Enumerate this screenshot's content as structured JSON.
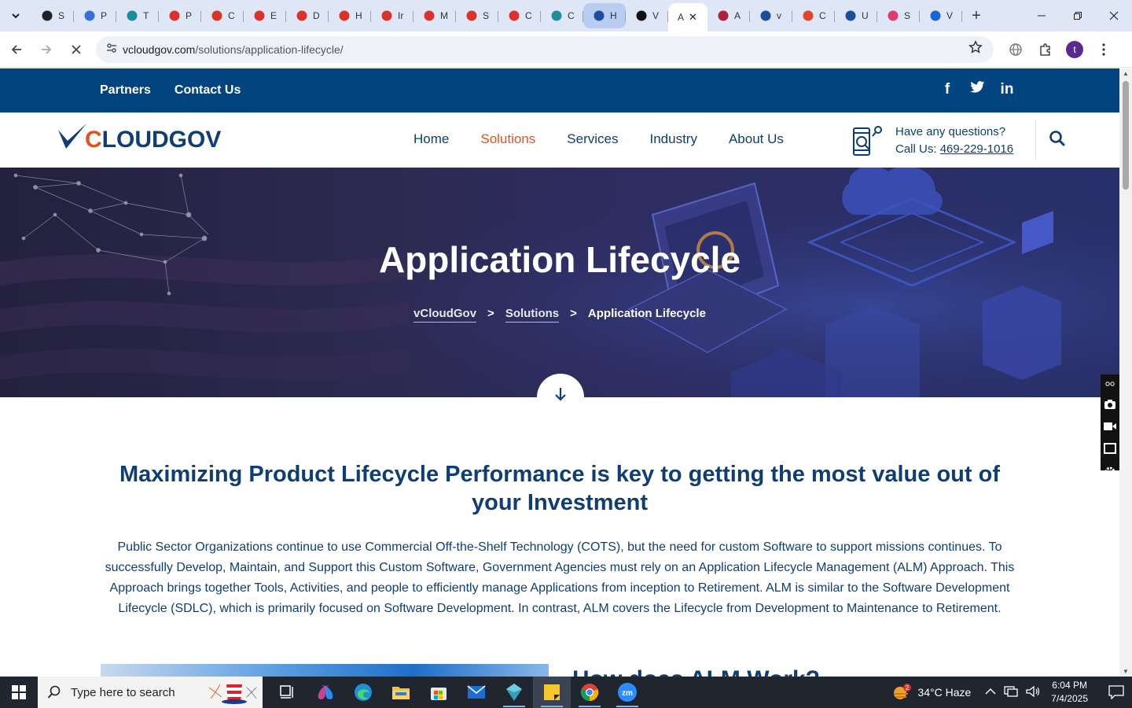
{
  "browser": {
    "tabs": [
      {
        "letter": "S",
        "color": "#222222"
      },
      {
        "letter": "P",
        "color": "#3a6fd8"
      },
      {
        "letter": "T",
        "color": "#1c8d9a"
      },
      {
        "letter": "P",
        "color": "#d8342b"
      },
      {
        "letter": "C",
        "color": "#d8342b"
      },
      {
        "letter": "E",
        "color": "#d8342b"
      },
      {
        "letter": "D",
        "color": "#d8342b"
      },
      {
        "letter": "H",
        "color": "#d8342b"
      },
      {
        "letter": "Ir",
        "color": "#d8342b"
      },
      {
        "letter": "M",
        "color": "#d8342b"
      },
      {
        "letter": "S",
        "color": "#d8342b"
      },
      {
        "letter": "C",
        "color": "#d8342b"
      },
      {
        "letter": "C",
        "color": "#1c8d9a"
      },
      {
        "letter": "H",
        "color": "#1d4e9c"
      },
      {
        "letter": "V",
        "color": "#111111"
      },
      {
        "letter": "A",
        "color": "#ffffff"
      },
      {
        "letter": "A",
        "color": "#b0213a"
      },
      {
        "letter": "v",
        "color": "#1d4e9c"
      },
      {
        "letter": "C",
        "color": "#e2452c"
      },
      {
        "letter": "U",
        "color": "#1d4e9c"
      },
      {
        "letter": "S",
        "color": "#e23c6c"
      },
      {
        "letter": "V",
        "color": "#1a64d6"
      }
    ],
    "active_tab_close": "✕",
    "new_tab": "+",
    "url_host": "vcloudgov.com",
    "url_path": "/solutions/application-lifecycle/"
  },
  "site": {
    "topbar_links": [
      "Partners",
      "Contact Us"
    ],
    "social": [
      "f",
      "t",
      "in"
    ],
    "logo_c1": "C",
    "logo_rest": "LOUDGOV",
    "menu": [
      "Home",
      "Solutions",
      "Services",
      "Industry",
      "About Us"
    ],
    "contact_line1": "Have any questions?",
    "contact_line2_prefix": "Call Us: ",
    "contact_phone": "469-229-1016"
  },
  "hero": {
    "title": "Application Lifecycle",
    "crumb_home": "vCloudGov",
    "crumb_mid": "Solutions",
    "crumb_current": "Application Lifecycle",
    "crumb_sep": ">"
  },
  "content": {
    "heading": "Maximizing Product Lifecycle Performance is key to getting the most value out of your Investment",
    "paragraph": "Public Sector Organizations continue to use Commercial Off-the-Shelf Technology (COTS), but the need for custom Software to support missions continues. To successfully Develop, Maintain, and Support this Custom Software, Government Agencies must rely on an Application Lifecycle Management (ALM) Approach. This Approach brings together Tools, Activities, and people to efficiently manage Applications from inception to Retirement. ALM is similar to the Software Development Lifecycle (SDLC), which is primarily focused on Software Development. In contrast, ALM covers the Lifecycle from Development to Maintenance to Retirement.",
    "next_heading": "How does ALM Work?"
  },
  "taskbar": {
    "search_placeholder": "Type here to search",
    "weather": "34°C  Haze",
    "weather_badge": "2",
    "time": "6:04 PM",
    "date": "7/4/2025"
  }
}
